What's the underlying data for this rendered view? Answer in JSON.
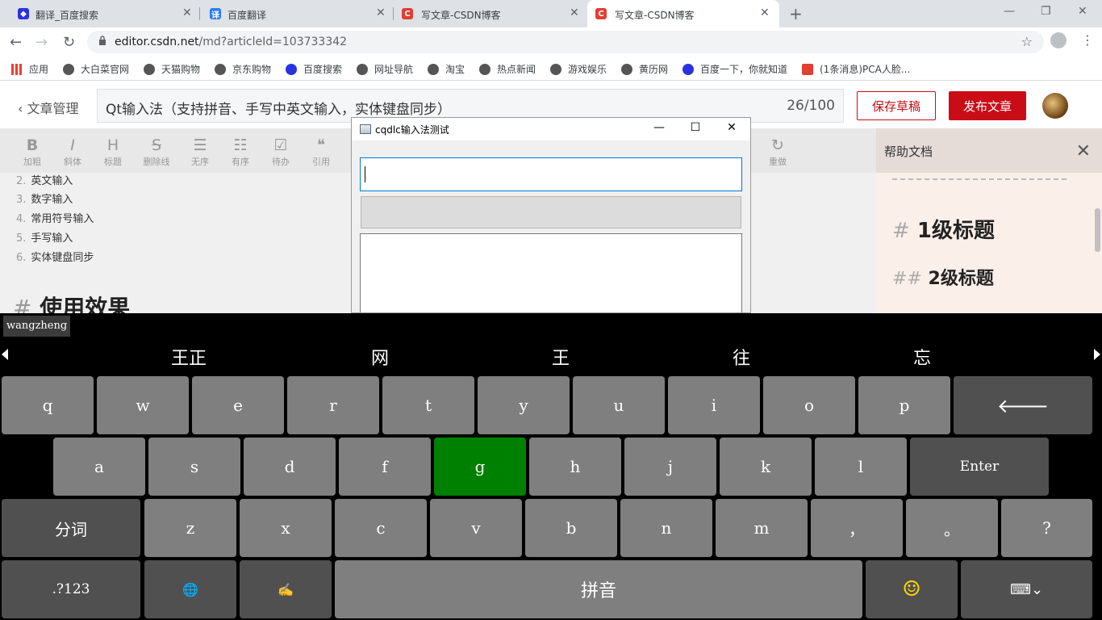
{
  "browser": {
    "tabs": [
      {
        "title": "翻译_百度搜索",
        "favicon": "baidu-paw-icon",
        "active": false
      },
      {
        "title": "百度翻译",
        "favicon": "translate-icon",
        "active": false
      },
      {
        "title": "写文章-CSDN博客",
        "favicon": "csdn-icon",
        "active": false
      },
      {
        "title": "写文章-CSDN博客",
        "favicon": "csdn-icon",
        "active": true
      }
    ],
    "url_host": "editor.csdn.net",
    "url_path": "/md?articleId=103733342",
    "bookmarks": [
      "应用",
      "大白菜官网",
      "天猫购物",
      "京东购物",
      "百度搜索",
      "网址导航",
      "淘宝",
      "热点新闻",
      "游戏娱乐",
      "黄历网",
      "百度一下，你就知道",
      "(1条消息)PCA人脸..."
    ]
  },
  "editor": {
    "back_label": "文章管理",
    "article_title": "Qt输入法（支持拼音、手写中英文输入，实体键盘同步）",
    "title_count": "26/100",
    "save_draft": "保存草稿",
    "publish": "发布文章",
    "toolbar": [
      {
        "glyph": "B",
        "label": "加粗"
      },
      {
        "glyph": "I",
        "label": "斜体"
      },
      {
        "glyph": "H",
        "label": "标题"
      },
      {
        "glyph": "S",
        "label": "删除线"
      },
      {
        "glyph": "☰",
        "label": "无序"
      },
      {
        "glyph": "☷",
        "label": "有序"
      },
      {
        "glyph": "☑",
        "label": "待办"
      },
      {
        "glyph": "❝",
        "label": "引用"
      }
    ],
    "redo_label": "重做",
    "list_items": [
      {
        "num": "2.",
        "text": "英文输入"
      },
      {
        "num": "3.",
        "text": "数字输入"
      },
      {
        "num": "4.",
        "text": "常用符号输入"
      },
      {
        "num": "5.",
        "text": "手写输入"
      },
      {
        "num": "6.",
        "text": "实体键盘同步"
      }
    ],
    "heading_hash": "#",
    "heading_text": "使用效果"
  },
  "help": {
    "title": "帮助文档",
    "h1_hash": "#",
    "h1_text": "1级标题",
    "h2_hash": "##",
    "h2_text": "2级标题"
  },
  "dialog": {
    "title": "cqdlc输入法测试",
    "input1_value": "",
    "input2_value": "",
    "textarea_value": ""
  },
  "ime": {
    "pinyin": "wangzheng",
    "candidates": [
      "王正",
      "网",
      "王",
      "往",
      "忘"
    ],
    "row1": [
      "q",
      "w",
      "e",
      "r",
      "t",
      "y",
      "u",
      "i",
      "o",
      "p"
    ],
    "row2": [
      "a",
      "s",
      "d",
      "f",
      "g",
      "h",
      "j",
      "k",
      "l"
    ],
    "enter_label": "Enter",
    "selected_key": "g",
    "row3_left": "分词",
    "row3": [
      "z",
      "x",
      "c",
      "v",
      "b",
      "n",
      "m",
      "，",
      "。",
      "?"
    ],
    "num_label": ".?123",
    "space_label": "拼音",
    "colors": {
      "selected": "#008000",
      "key": "#7f7f7f",
      "dark_key": "#505050",
      "emoji": "#ffd700"
    }
  }
}
